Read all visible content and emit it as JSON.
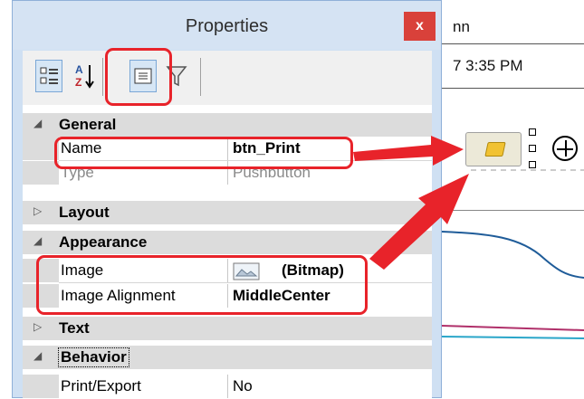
{
  "window": {
    "title": "Properties",
    "close_glyph": "x"
  },
  "background": {
    "column_header_fragment": "nn",
    "time_fragment": "7 3:35 PM"
  },
  "toolbar": {
    "items": [
      {
        "icon": "categorized-icon"
      },
      {
        "icon": "alphabetical-sort-icon",
        "glyph": "A Z"
      },
      {
        "icon": "property-pages-icon"
      },
      {
        "icon": "filter-icon"
      }
    ]
  },
  "grid": {
    "categories": {
      "general": {
        "label": "General",
        "toggle": "◢"
      },
      "layout": {
        "label": "Layout",
        "toggle": "▷"
      },
      "appearance": {
        "label": "Appearance",
        "toggle": "◢"
      },
      "text": {
        "label": "Text",
        "toggle": "▷"
      },
      "behavior": {
        "label": "Behavior",
        "toggle": "◢"
      }
    },
    "properties": {
      "name": {
        "label": "Name",
        "value": "btn_Print"
      },
      "type": {
        "label": "Type",
        "value": "Pushbutton"
      },
      "image": {
        "label": "Image",
        "value": "(Bitmap)"
      },
      "image_alignment": {
        "label": "Image Alignment",
        "value": "MiddleCenter"
      },
      "print_export": {
        "label": "Print/Export",
        "value": "No"
      }
    }
  },
  "colors": {
    "highlight": "#e8232a",
    "dialog_frame": "#cfe0f3",
    "close_button": "#d9413a",
    "chart_line_blue": "#1f5c99",
    "chart_line_magenta": "#b0306a",
    "chart_line_cyan": "#2aa6c9"
  }
}
